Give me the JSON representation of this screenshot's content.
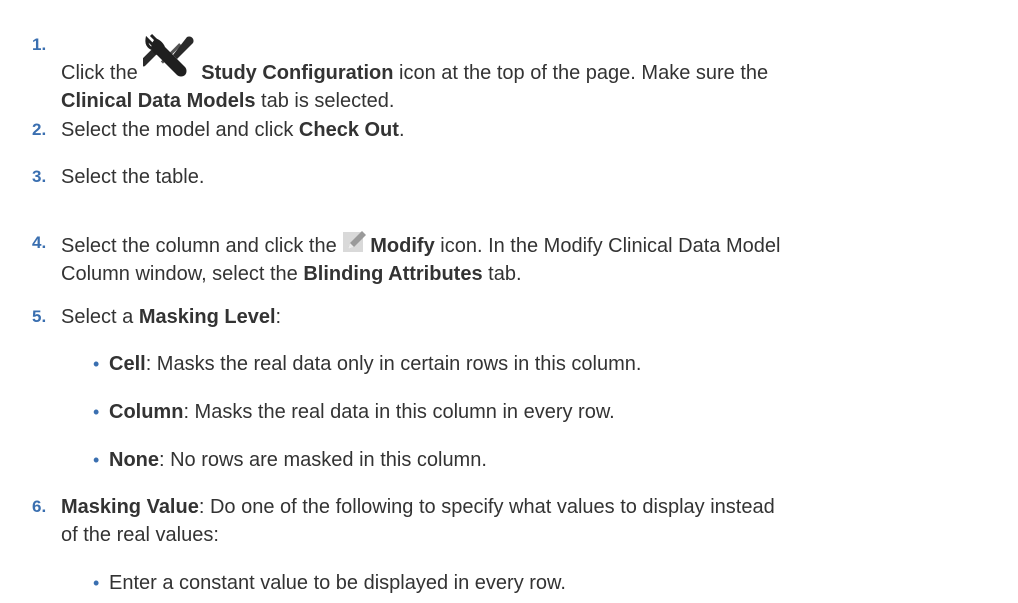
{
  "steps": [
    {
      "number": "1.",
      "parts": [
        {
          "t": "Click the ",
          "b": false
        },
        {
          "icon": "wrench-screwdriver-icon"
        },
        {
          "t": "Study Configuration",
          "b": true
        },
        {
          "t": " icon at the top of the page. Make sure the ",
          "b": false
        },
        {
          "br": true
        },
        {
          "t": "Clinical Data Models",
          "b": true
        },
        {
          "t": " tab is selected.",
          "b": false
        }
      ]
    },
    {
      "number": "2.",
      "parts": [
        {
          "t": "Select the model and click ",
          "b": false
        },
        {
          "t": "Check Out",
          "b": true
        },
        {
          "t": ".",
          "b": false
        }
      ]
    },
    {
      "number": "3.",
      "parts": [
        {
          "t": "Select the table.",
          "b": false
        }
      ]
    },
    {
      "number": "4.",
      "parts": [
        {
          "t": "Select the column and click the ",
          "b": false
        },
        {
          "icon": "pencil-icon"
        },
        {
          "t": "Modify",
          "b": true
        },
        {
          "t": " icon. In the Modify Clinical Data Model",
          "b": false
        },
        {
          "br": true
        },
        {
          "t": "Column window, select the ",
          "b": false
        },
        {
          "t": "Blinding Attributes",
          "b": true
        },
        {
          "t": " tab.",
          "b": false
        }
      ]
    },
    {
      "number": "5.",
      "parts": [
        {
          "t": "Select a ",
          "b": false
        },
        {
          "t": "Masking Level",
          "b": true
        },
        {
          "t": ":",
          "b": false
        }
      ],
      "bullets": [
        [
          {
            "t": "Cell",
            "b": true
          },
          {
            "t": ": Masks the real data only in certain rows in this column.",
            "b": false
          }
        ],
        [
          {
            "t": "Column",
            "b": true
          },
          {
            "t": ": Masks the real data in this column in every row.",
            "b": false
          }
        ],
        [
          {
            "t": "None",
            "b": true
          },
          {
            "t": ": No rows are masked in this column.",
            "b": false
          }
        ]
      ]
    },
    {
      "number": "6.",
      "parts": [
        {
          "t": "Masking Value",
          "b": true
        },
        {
          "t": ": Do one of the following to specify what values to display instead",
          "b": false
        },
        {
          "br": true
        },
        {
          "t": "of the real values:",
          "b": false
        }
      ],
      "bullets": [
        [
          {
            "t": "Enter a constant value to be displayed in every row.",
            "b": false
          }
        ]
      ]
    }
  ],
  "bullet_glyph": "•",
  "colors": {
    "text": "#333333",
    "number": "#3a6fb0",
    "bullet": "#3a6fb0"
  }
}
